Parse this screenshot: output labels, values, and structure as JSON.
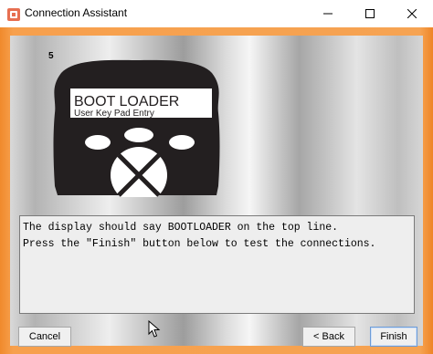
{
  "window": {
    "title": "Connection Assistant",
    "controls": [
      "minimize-icon",
      "maximize-icon",
      "close-icon"
    ]
  },
  "step": {
    "number": "5"
  },
  "device": {
    "screen_line1": "BOOT LOADER",
    "screen_line2": "User Key Pad Entry"
  },
  "message": {
    "line1": "The display should say BOOTLOADER on the top line.",
    "line2": "Press the \"Finish\" button below to test the connections."
  },
  "buttons": {
    "cancel": "Cancel",
    "back": "< Back",
    "finish": "Finish"
  },
  "colors": {
    "frame_orange": "#f7a04d",
    "device_body": "#231f20"
  }
}
